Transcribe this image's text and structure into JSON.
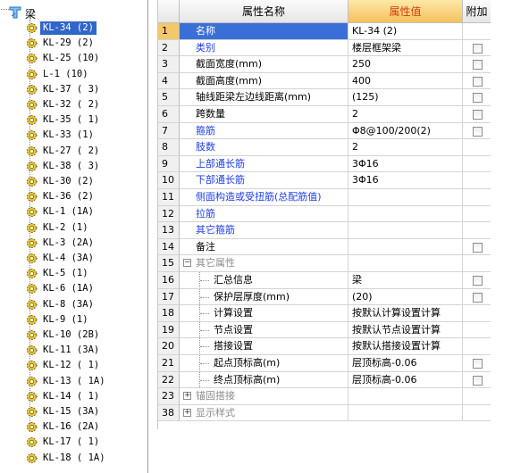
{
  "tree": {
    "root_label": "梁",
    "items": [
      "KL-34 (2)",
      "KL-29 (2)",
      "KL-25 (10)",
      "L-1 (10)",
      "KL-37 ( 3)",
      "KL-32 ( 2)",
      "KL-35 ( 1)",
      "KL-33 (1)",
      "KL-27 ( 2)",
      "KL-38 ( 3)",
      "KL-30 (2)",
      "KL-36 (2)",
      "KL-1 (1A)",
      "KL-2 (1)",
      "KL-3 (2A)",
      "KL-4 (3A)",
      "KL-5 (1)",
      "KL-6 (1A)",
      "KL-8 (3A)",
      "KL-9 (1)",
      "KL-10 (2B)",
      "KL-11 (3A)",
      "KL-12 ( 1)",
      "KL-13 ( 1A)",
      "KL-14 ( 1)",
      "KL-15 (3A)",
      "KL-16 (2A)",
      "KL-17 ( 1)",
      "KL-18 ( 1A)"
    ],
    "selected_index": 0
  },
  "grid": {
    "headers": {
      "num": "",
      "name": "属性名称",
      "value": "属性值",
      "add": "附加"
    },
    "rows": [
      {
        "num": "1",
        "name": "名称",
        "value": "KL-34 (2)",
        "style": "blue",
        "chk": false
      },
      {
        "num": "2",
        "name": "类别",
        "value": "楼层框架梁",
        "style": "blue",
        "chk": true
      },
      {
        "num": "3",
        "name": "截面宽度(mm)",
        "value": "250",
        "style": "",
        "chk": true
      },
      {
        "num": "4",
        "name": "截面高度(mm)",
        "value": "400",
        "style": "",
        "chk": true
      },
      {
        "num": "5",
        "name": "轴线距梁左边线距离(mm)",
        "value": "(125)",
        "style": "",
        "chk": true
      },
      {
        "num": "6",
        "name": "跨数量",
        "value": "2",
        "style": "",
        "chk": true
      },
      {
        "num": "7",
        "name": "箍筋",
        "value": "Φ8@100/200(2)",
        "style": "blue",
        "chk": true
      },
      {
        "num": "8",
        "name": "肢数",
        "value": "2",
        "style": "blue",
        "chk": false
      },
      {
        "num": "9",
        "name": "上部通长筋",
        "value": "3Φ16",
        "style": "blue",
        "chk": false
      },
      {
        "num": "10",
        "name": "下部通长筋",
        "value": "3Φ16",
        "style": "blue",
        "chk": false
      },
      {
        "num": "11",
        "name": "侧面构造或受扭筋(总配筋值)",
        "value": "",
        "style": "blue",
        "chk": false
      },
      {
        "num": "12",
        "name": "拉筋",
        "value": "",
        "style": "blue",
        "chk": false
      },
      {
        "num": "13",
        "name": "其它箍筋",
        "value": "",
        "style": "blue",
        "chk": false
      },
      {
        "num": "14",
        "name": "备注",
        "value": "",
        "style": "",
        "chk": true
      },
      {
        "num": "15",
        "name": "其它属性",
        "value": "",
        "style": "gray",
        "chk": false,
        "expander": "−",
        "section": true
      },
      {
        "num": "16",
        "name": "汇总信息",
        "value": "梁",
        "style": "",
        "chk": true,
        "sub": true
      },
      {
        "num": "17",
        "name": "保护层厚度(mm)",
        "value": "(20)",
        "style": "",
        "chk": true,
        "sub": true
      },
      {
        "num": "18",
        "name": "计算设置",
        "value": "按默认计算设置计算",
        "style": "",
        "chk": false,
        "sub": true
      },
      {
        "num": "19",
        "name": "节点设置",
        "value": "按默认节点设置计算",
        "style": "",
        "chk": false,
        "sub": true
      },
      {
        "num": "20",
        "name": "搭接设置",
        "value": "按默认搭接设置计算",
        "style": "",
        "chk": false,
        "sub": true
      },
      {
        "num": "21",
        "name": "起点顶标高(m)",
        "value": "层顶标高-0.06",
        "style": "",
        "chk": true,
        "sub": true
      },
      {
        "num": "22",
        "name": "终点顶标高(m)",
        "value": "层顶标高-0.06",
        "style": "",
        "chk": true,
        "sub": true
      },
      {
        "num": "23",
        "name": "锚固搭接",
        "value": "",
        "style": "gray",
        "chk": false,
        "expander": "+",
        "section": true
      },
      {
        "num": "38",
        "name": "显示样式",
        "value": "",
        "style": "gray",
        "chk": false,
        "expander": "+",
        "section": true
      }
    ]
  }
}
